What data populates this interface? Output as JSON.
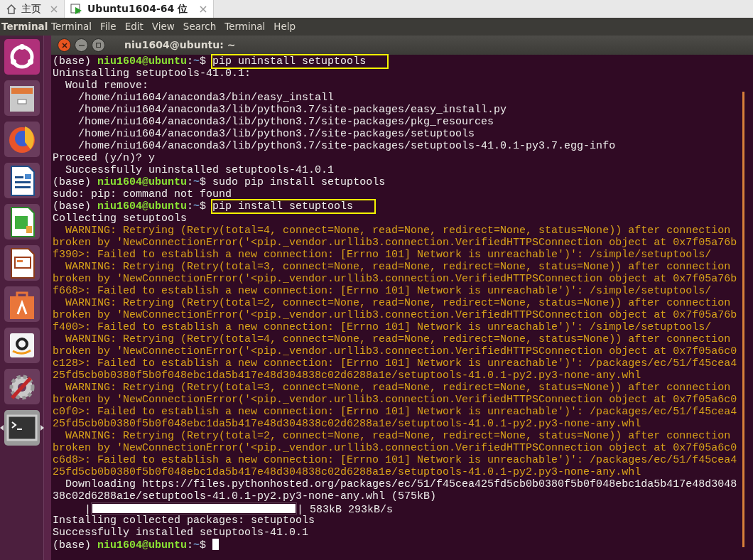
{
  "browser_tabs": [
    {
      "label": "主页",
      "selected": false
    },
    {
      "label": "Ubuntu1604-64 位",
      "selected": true
    }
  ],
  "menubar": {
    "app_title": "Terminal",
    "menus": [
      "Terminal",
      "File",
      "Edit",
      "View",
      "Search",
      "Terminal",
      "Help"
    ]
  },
  "launcher": {
    "items": [
      {
        "running": false
      },
      {
        "running": false
      },
      {
        "running": false
      },
      {
        "running": false
      },
      {
        "running": false
      },
      {
        "running": false
      },
      {
        "running": false
      },
      {
        "running": false
      },
      {
        "running": false
      },
      {
        "running": true
      }
    ]
  },
  "terminal": {
    "title": "niu1604@ubuntu: ~",
    "lines": [
      {
        "kind": "prompt",
        "env": "(base) ",
        "host": "niu1604@ubuntu",
        "sep": ":",
        "path": "~",
        "symbol": "$ ",
        "command": "pip uninstall setuptools",
        "highlighted": true
      },
      {
        "kind": "output",
        "text": "Uninstalling setuptools-41.0.1:"
      },
      {
        "kind": "output",
        "text": "  Would remove:"
      },
      {
        "kind": "output",
        "text": "    /home/niu1604/anaconda3/bin/easy_install"
      },
      {
        "kind": "output",
        "text": "    /home/niu1604/anaconda3/lib/python3.7/site-packages/easy_install.py"
      },
      {
        "kind": "output",
        "text": "    /home/niu1604/anaconda3/lib/python3.7/site-packages/pkg_resources"
      },
      {
        "kind": "output",
        "text": "    /home/niu1604/anaconda3/lib/python3.7/site-packages/setuptools"
      },
      {
        "kind": "output",
        "text": "    /home/niu1604/anaconda3/lib/python3.7/site-packages/setuptools-41.0.1-py3.7.egg-info"
      },
      {
        "kind": "output",
        "text": "Proceed (y/n)? y"
      },
      {
        "kind": "output",
        "text": "  Successfully uninstalled setuptools-41.0.1"
      },
      {
        "kind": "prompt",
        "env": "(base) ",
        "host": "niu1604@ubuntu",
        "sep": ":",
        "path": "~",
        "symbol": "$ ",
        "command": "sudo pip install setuptools",
        "highlighted": false
      },
      {
        "kind": "output",
        "text": "sudo: pip: command not found"
      },
      {
        "kind": "prompt",
        "env": "(base) ",
        "host": "niu1604@ubuntu",
        "sep": ":",
        "path": "~",
        "symbol": "$ ",
        "command": "pip install setuptools",
        "highlighted": true
      },
      {
        "kind": "output",
        "text": "Collecting setuptools"
      },
      {
        "kind": "warning",
        "text": "  WARNING: Retrying (Retry(total=4, connect=None, read=None, redirect=None, status=None)) after connection"
      },
      {
        "kind": "warning",
        "text": "broken by 'NewConnectionError('<pip._vendor.urllib3.connection.VerifiedHTTPSConnection object at 0x7f05a76b"
      },
      {
        "kind": "warning",
        "text": "f390>: Failed to establish a new connection: [Errno 101] Network is unreachable')': /simple/setuptools/"
      },
      {
        "kind": "warning",
        "text": "  WARNING: Retrying (Retry(total=3, connect=None, read=None, redirect=None, status=None)) after connection"
      },
      {
        "kind": "warning",
        "text": "broken by 'NewConnectionError('<pip._vendor.urllib3.connection.VerifiedHTTPSConnection object at 0x7f05a76b"
      },
      {
        "kind": "warning",
        "text": "f668>: Failed to establish a new connection: [Errno 101] Network is unreachable')': /simple/setuptools/"
      },
      {
        "kind": "warning",
        "text": "  WARNING: Retrying (Retry(total=2, connect=None, read=None, redirect=None, status=None)) after connection"
      },
      {
        "kind": "warning",
        "text": "broken by 'NewConnectionError('<pip._vendor.urllib3.connection.VerifiedHTTPSConnection object at 0x7f05a76b"
      },
      {
        "kind": "warning",
        "text": "f400>: Failed to establish a new connection: [Errno 101] Network is unreachable')': /simple/setuptools/"
      },
      {
        "kind": "warning",
        "text": "  WARNING: Retrying (Retry(total=4, connect=None, read=None, redirect=None, status=None)) after connection"
      },
      {
        "kind": "warning",
        "text": "broken by 'NewConnectionError('<pip._vendor.urllib3.connection.VerifiedHTTPSConnection object at 0x7f05a6c0"
      },
      {
        "kind": "warning",
        "text": "c128>: Failed to establish a new connection: [Errno 101] Network is unreachable')': /packages/ec/51/f45cea4"
      },
      {
        "kind": "warning",
        "text": "25fd5cb0b0380f5b0f048ebc1da5b417e48d304838c02d6288a1e/setuptools-41.0.1-py2.py3-none-any.whl"
      },
      {
        "kind": "warning",
        "text": "  WARNING: Retrying (Retry(total=3, connect=None, read=None, redirect=None, status=None)) after connection"
      },
      {
        "kind": "warning",
        "text": "broken by 'NewConnectionError('<pip._vendor.urllib3.connection.VerifiedHTTPSConnection object at 0x7f05a6c0"
      },
      {
        "kind": "warning",
        "text": "c0f0>: Failed to establish a new connection: [Errno 101] Network is unreachable')': /packages/ec/51/f45cea4"
      },
      {
        "kind": "warning",
        "text": "25fd5cb0b0380f5b0f048ebc1da5b417e48d304838c02d6288a1e/setuptools-41.0.1-py2.py3-none-any.whl"
      },
      {
        "kind": "warning",
        "text": "  WARNING: Retrying (Retry(total=2, connect=None, read=None, redirect=None, status=None)) after connection"
      },
      {
        "kind": "warning",
        "text": "broken by 'NewConnectionError('<pip._vendor.urllib3.connection.VerifiedHTTPSConnection object at 0x7f05a6c0"
      },
      {
        "kind": "warning",
        "text": "c6d8>: Failed to establish a new connection: [Errno 101] Network is unreachable')': /packages/ec/51/f45cea4"
      },
      {
        "kind": "warning",
        "text": "25fd5cb0b0380f5b0f048ebc1da5b417e48d304838c02d6288a1e/setuptools-41.0.1-py2.py3-none-any.whl"
      },
      {
        "kind": "output",
        "text": "  Downloading https://files.pythonhosted.org/packages/ec/51/f45cea425fd5cb0b0380f5b0f048ebc1da5b417e48d3048"
      },
      {
        "kind": "output",
        "text": "38c02d6288a1e/setuptools-41.0.1-py2.py3-none-any.whl (575kB)"
      },
      {
        "kind": "progress",
        "prefix": "     |",
        "level": 1,
        "suffix": "| 583kB 293kB/s"
      },
      {
        "kind": "output",
        "text": "Installing collected packages: setuptools"
      },
      {
        "kind": "output",
        "text": "Successfully installed setuptools-41.0.1"
      },
      {
        "kind": "prompt",
        "env": "(base) ",
        "host": "niu1604@ubuntu",
        "sep": ":",
        "path": "~",
        "symbol": "$ ",
        "cursor": true
      }
    ]
  }
}
